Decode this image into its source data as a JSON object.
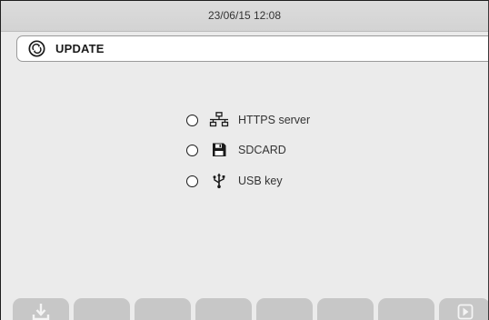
{
  "status_bar": {
    "datetime": "23/06/15 12:08"
  },
  "title_bar": {
    "title": "UPDATE",
    "icon": "refresh-icon"
  },
  "options": [
    {
      "label": "HTTPS server",
      "icon": "network-icon",
      "selected": false
    },
    {
      "label": "SDCARD",
      "icon": "floppy-disk-icon",
      "selected": false
    },
    {
      "label": "USB key",
      "icon": "usb-icon",
      "selected": false
    }
  ],
  "function_keys": {
    "keys": [
      {
        "icon": "download-icon"
      },
      {
        "icon": ""
      },
      {
        "icon": ""
      },
      {
        "icon": ""
      },
      {
        "icon": ""
      },
      {
        "icon": ""
      },
      {
        "icon": ""
      },
      {
        "icon": "play-next-icon"
      }
    ]
  },
  "colors": {
    "background": "#ebebeb",
    "status_bar": "#d6d6d6",
    "function_key": "#c7c7c7",
    "text": "#333333"
  }
}
